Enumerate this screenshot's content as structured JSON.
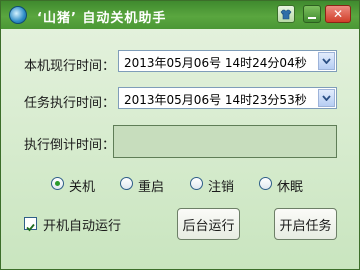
{
  "titlebar": {
    "title": "‘山猪’ 自动关机助手"
  },
  "fields": {
    "current_time_label": "本机现行时间：",
    "current_time_value": "2013年05月06号  14时24分04秒",
    "task_time_label": "任务执行时间：",
    "task_time_value": "2013年05月06号  14时23分53秒",
    "countdown_label": "执行倒计时间：",
    "countdown_value": ""
  },
  "actions": {
    "selected": "关机",
    "options": [
      "关机",
      "重启",
      "注销",
      "休眠"
    ]
  },
  "autostart": {
    "label": "开机自动运行",
    "checked": true
  },
  "buttons": {
    "background_run": "后台运行",
    "start_task": "开启任务"
  },
  "colors": {
    "titlebar": "#4a9735",
    "content_bg": "#d8ecd0",
    "radio_dot": "#2a9a2a"
  }
}
